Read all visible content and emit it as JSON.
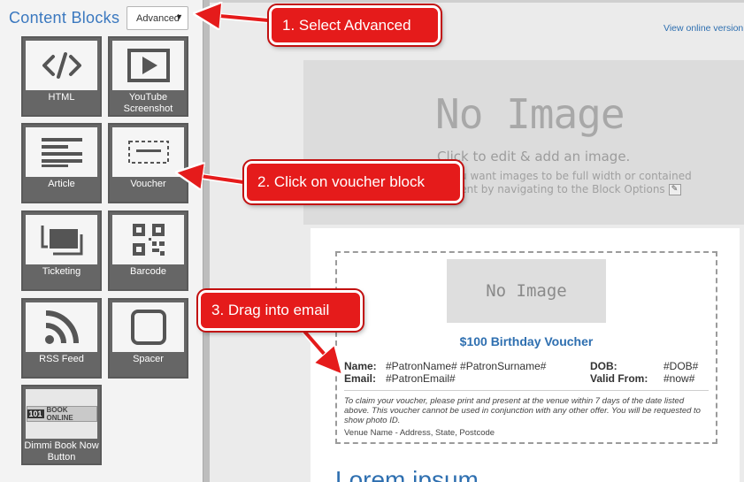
{
  "sidebar": {
    "title": "Content Blocks",
    "mode_select": {
      "value": "Advanced"
    },
    "blocks": [
      {
        "label": "HTML",
        "icon": "code-icon"
      },
      {
        "label": "YouTube Screenshot",
        "icon": "play-icon"
      },
      {
        "label": "Article",
        "icon": "text-lines-icon"
      },
      {
        "label": "Voucher",
        "icon": "voucher-icon"
      },
      {
        "label": "Ticketing",
        "icon": "tickets-icon"
      },
      {
        "label": "Barcode",
        "icon": "qr-code-icon"
      },
      {
        "label": "RSS Feed",
        "icon": "rss-icon"
      },
      {
        "label": "Spacer",
        "icon": "spacer-icon"
      },
      {
        "label": "Dimmi Book Now Button",
        "icon": "book-online-logo",
        "logo_text": "BOOK ONLINE"
      }
    ]
  },
  "canvas": {
    "view_online": "View online version",
    "hero": {
      "title": "No Image",
      "subtitle": "Click to edit & add an image.",
      "note": "If you want images to be full width or contained content by navigating to the Block Options"
    },
    "voucher": {
      "image_text": "No Image",
      "title": "$100 Birthday Voucher",
      "name_label": "Name:",
      "name_value": "#PatronName# #PatronSurname#",
      "dob_label": "DOB:",
      "dob_value": "#DOB#",
      "email_label": "Email:",
      "email_value": "#PatronEmail#",
      "valid_label": "Valid From:",
      "valid_value": "#now#",
      "terms": "To claim your voucher, please print and present at the venue within 7 days of the date listed above. This voucher cannot be used in conjunction with any other offer. You will be requested to show photo ID.",
      "venue": "Venue Name - Address, State, Postcode"
    },
    "lorem_heading": "Lorem ipsum"
  },
  "callouts": [
    {
      "text": "1. Select Advanced"
    },
    {
      "text": "2. Click on voucher block"
    },
    {
      "text": "3. Drag into email"
    }
  ],
  "colors": {
    "accent_blue": "#3a78bf",
    "link_blue": "#2e6fb0",
    "callout_red": "#e51b1b",
    "block_tile": "#666666"
  }
}
